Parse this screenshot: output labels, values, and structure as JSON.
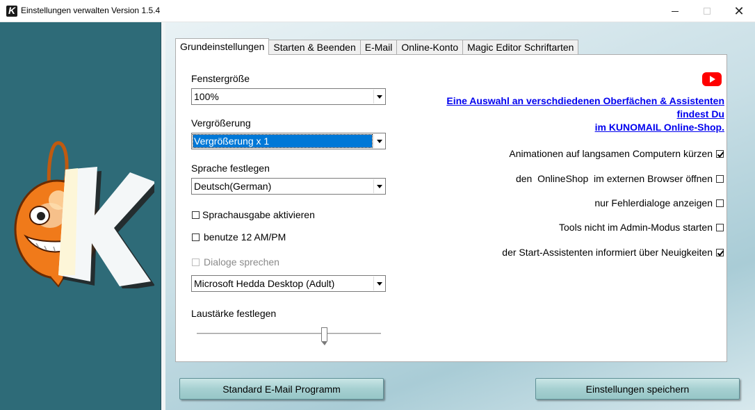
{
  "window": {
    "title": "Einstellungen verwalten Version 1.5.4",
    "minimize_icon": "minimize-icon",
    "maximize_icon": "maximize-icon",
    "close_icon": "close-icon"
  },
  "tabs": [
    {
      "label": "Grundeinstellungen",
      "active": true
    },
    {
      "label": "Starten & Beenden",
      "active": false
    },
    {
      "label": "E-Mail",
      "active": false
    },
    {
      "label": "Online-Konto",
      "active": false
    },
    {
      "label": "Magic Editor Schriftarten",
      "active": false
    }
  ],
  "settings": {
    "window_size": {
      "label": "Fenstergröße",
      "value": "100%"
    },
    "zoom": {
      "label": "Vergrößerung",
      "value": "Vergrößerung x 1"
    },
    "language": {
      "label": "Sprache festlegen",
      "value": "Deutsch(German)"
    },
    "speech_output": {
      "label": "Sprachausgabe aktivieren",
      "checked": false
    },
    "ampm": {
      "label": "benutze 12 AM/PM",
      "checked": false
    },
    "speak_dialogs": {
      "label": "Dialoge sprechen",
      "checked": false,
      "disabled": true
    },
    "voice": {
      "value": "Microsoft Hedda Desktop (Adult)"
    },
    "volume": {
      "label": "Laustärke festlegen",
      "level_percent": 70
    }
  },
  "shop_link": {
    "line1": "Eine Auswahl an verschdiedenen Oberfächen & Assistenten findest Du",
    "line2": "im KUNOMAIL Online-Shop."
  },
  "options": [
    {
      "label": "Animationen auf langsamen Computern kürzen",
      "checked": true
    },
    {
      "label": "den  OnlineShop  im externen Browser öffnen",
      "checked": false
    },
    {
      "label": "nur Fehlerdialoge anzeigen",
      "checked": false
    },
    {
      "label": "Tools nicht im Admin-Modus starten",
      "checked": false
    },
    {
      "label": "der Start-Assistenten informiert über Neuigkeiten",
      "checked": true
    }
  ],
  "buttons": {
    "default_mail": "Standard E-Mail Programm",
    "save": "Einstellungen speichern"
  },
  "colors": {
    "sidebar": "#2e6b78",
    "link": "#0000ee",
    "selection": "#0078d7",
    "button": "#a6d0d1"
  }
}
